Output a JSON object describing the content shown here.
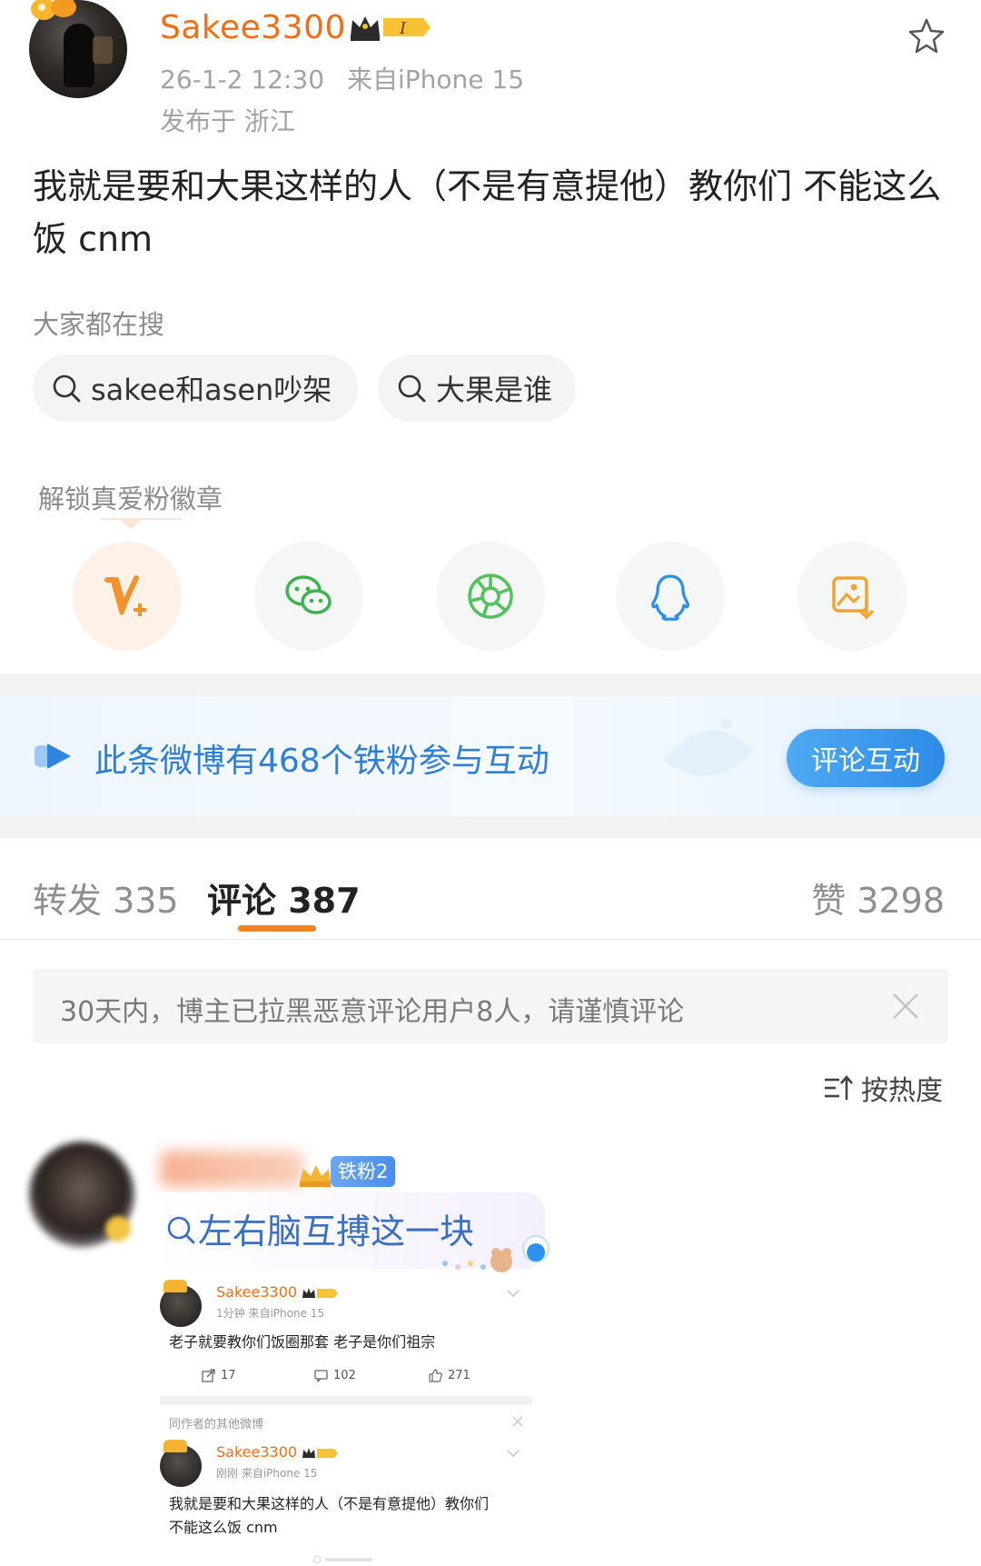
{
  "post": {
    "username": "Sakee3300",
    "timestamp": "26-1-2 12:30",
    "source": "来自iPhone 15",
    "location": "发布于 浙江",
    "text": "我就是要和大果这样的人（不是有意提他）教你们 不能这么饭 cnm"
  },
  "trending": {
    "label": "大家都在搜",
    "chips": [
      "sakee和asen吵架",
      "大果是谁"
    ]
  },
  "unlock": {
    "label": "解锁真爱粉徽章"
  },
  "share": {
    "icons": [
      "v-plus-icon",
      "wechat-icon",
      "moments-icon",
      "qq-icon",
      "save-image-icon"
    ]
  },
  "fans_banner": {
    "text": "此条微博有468个铁粉参与互动",
    "button": "评论互动"
  },
  "tabs": {
    "repost": "转发 335",
    "comment": "评论 387",
    "like": "赞 3298"
  },
  "notice": {
    "text": "30天内，博主已拉黑恶意评论用户8人，请谨慎评论"
  },
  "sort": {
    "label": "按热度"
  },
  "comment": {
    "fan_tag": "铁粉2",
    "search_text": "左右脑互搏这一块"
  },
  "embed": {
    "post1": {
      "username": "Sakee3300",
      "meta": "1分钟  来自iPhone 15",
      "text": "老子就要教你们饭圈那套 老子是你们祖宗",
      "reposts": "17",
      "comments": "102",
      "likes": "271"
    },
    "section_label": "同作者的其他微博",
    "post2": {
      "username": "Sakee3300",
      "meta": "刚刚  来自iPhone 15",
      "text": "我就是要和大果这样的人（不是有意提他）教你们不能这么饭 cnm"
    }
  },
  "colors": {
    "brand_orange": "#f26d13",
    "link_blue": "#2f7fd4",
    "tab_underline": "#f08427"
  }
}
